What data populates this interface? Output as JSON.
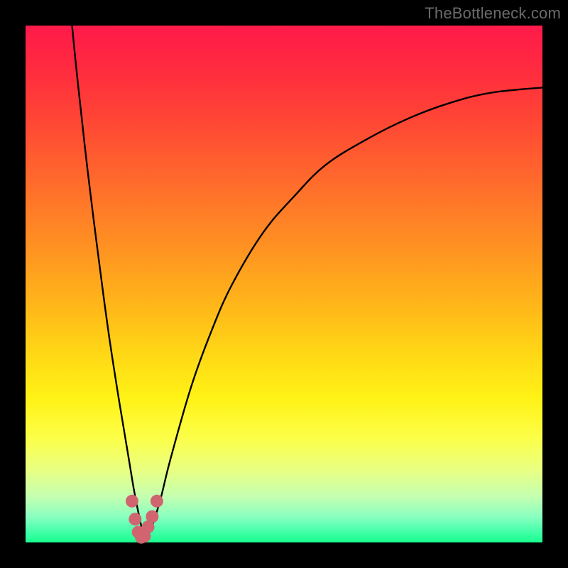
{
  "watermark": {
    "text": "TheBottleneck.com"
  },
  "colors": {
    "frame": "#000000",
    "curve": "#000000",
    "markers": "#d0646f"
  },
  "chart_data": {
    "type": "line",
    "title": "",
    "xlabel": "",
    "ylabel": "",
    "xlim": [
      0,
      100
    ],
    "ylim": [
      0,
      100
    ],
    "grid": false,
    "series": [
      {
        "name": "bottleneck-curve",
        "x": [
          9.0,
          10,
          12,
          14,
          16,
          18,
          20,
          21,
          22,
          23,
          24,
          26,
          28,
          32,
          36,
          40,
          46,
          52,
          58,
          66,
          74,
          82,
          90,
          100
        ],
        "y": [
          100,
          90,
          72,
          56,
          41,
          28,
          16,
          10,
          5,
          1,
          2,
          8,
          16,
          30,
          41,
          50,
          60,
          67,
          73,
          78,
          82,
          85,
          87,
          88
        ]
      }
    ],
    "markers": {
      "name": "highlight-points",
      "x": [
        20.6,
        21.2,
        21.8,
        22.4,
        23.0,
        23.7,
        24.5,
        25.4
      ],
      "y": [
        8.0,
        4.5,
        2.0,
        1.0,
        1.2,
        3.0,
        5.0,
        8.0
      ]
    }
  }
}
